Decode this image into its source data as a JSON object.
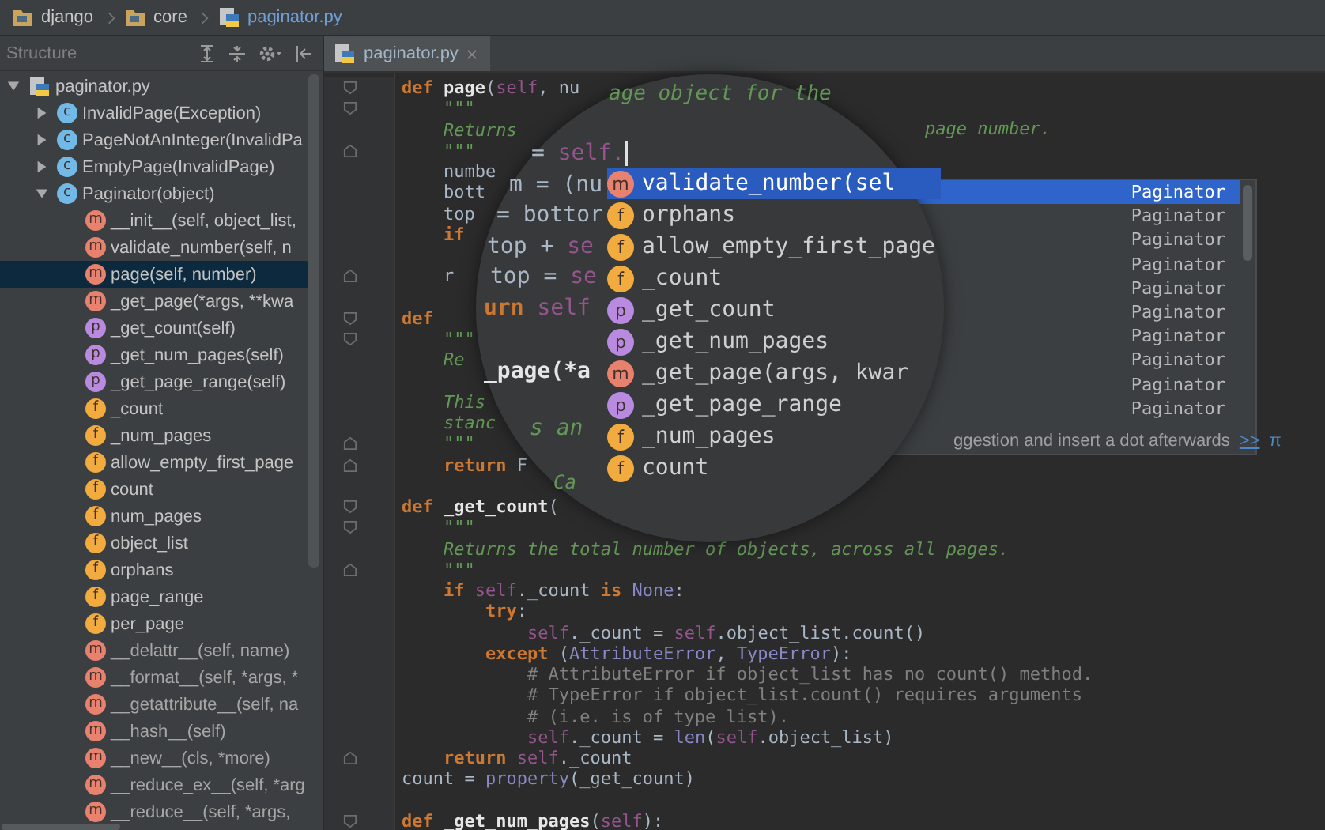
{
  "breadcrumbs": [
    {
      "kind": "folder",
      "label": "django"
    },
    {
      "kind": "folder",
      "label": "core"
    },
    {
      "kind": "file",
      "label": "paginator.py"
    }
  ],
  "structure": {
    "title": "Structure",
    "tree": [
      {
        "kind": "file",
        "label": "paginator.py",
        "expanded": true,
        "selected": false,
        "inherited": false,
        "children": [
          {
            "kind": "class",
            "badge": "c",
            "label": "InvalidPage(Exception)",
            "expanded": false,
            "selected": false,
            "inherited": false
          },
          {
            "kind": "class",
            "badge": "c",
            "label": "PageNotAnInteger(InvalidPa",
            "expanded": false,
            "selected": false,
            "inherited": false
          },
          {
            "kind": "class",
            "badge": "c",
            "label": "EmptyPage(InvalidPage)",
            "expanded": false,
            "selected": false,
            "inherited": false
          },
          {
            "kind": "class",
            "badge": "c",
            "label": "Paginator(object)",
            "expanded": true,
            "selected": false,
            "inherited": false,
            "children": [
              {
                "kind": "method",
                "badge": "m",
                "label": "__init__(self, object_list,",
                "selected": false,
                "inherited": false
              },
              {
                "kind": "method",
                "badge": "m",
                "label": "validate_number(self, n",
                "selected": false,
                "inherited": false
              },
              {
                "kind": "method",
                "badge": "m",
                "label": "page(self, number)",
                "selected": true,
                "inherited": false
              },
              {
                "kind": "method",
                "badge": "m",
                "label": "_get_page(*args, **kwa",
                "selected": false,
                "inherited": false
              },
              {
                "kind": "property",
                "badge": "p",
                "label": "_get_count(self)",
                "selected": false,
                "inherited": false
              },
              {
                "kind": "property",
                "badge": "p",
                "label": "_get_num_pages(self)",
                "selected": false,
                "inherited": false
              },
              {
                "kind": "property",
                "badge": "p",
                "label": "_get_page_range(self)",
                "selected": false,
                "inherited": false
              },
              {
                "kind": "field",
                "badge": "f",
                "label": "_count",
                "selected": false,
                "inherited": false
              },
              {
                "kind": "field",
                "badge": "f",
                "label": "_num_pages",
                "selected": false,
                "inherited": false
              },
              {
                "kind": "field",
                "badge": "f",
                "label": "allow_empty_first_page",
                "selected": false,
                "inherited": false
              },
              {
                "kind": "field",
                "badge": "f",
                "label": "count",
                "selected": false,
                "inherited": false
              },
              {
                "kind": "field",
                "badge": "f",
                "label": "num_pages",
                "selected": false,
                "inherited": false
              },
              {
                "kind": "field",
                "badge": "f",
                "label": "object_list",
                "selected": false,
                "inherited": false
              },
              {
                "kind": "field",
                "badge": "f",
                "label": "orphans",
                "selected": false,
                "inherited": false
              },
              {
                "kind": "field",
                "badge": "f",
                "label": "page_range",
                "selected": false,
                "inherited": false
              },
              {
                "kind": "field",
                "badge": "f",
                "label": "per_page",
                "selected": false,
                "inherited": false
              },
              {
                "kind": "method",
                "badge": "m",
                "label": "__delattr__(self, name)",
                "selected": false,
                "inherited": true
              },
              {
                "kind": "method",
                "badge": "m",
                "label": "__format__(self, *args, *",
                "selected": false,
                "inherited": true
              },
              {
                "kind": "method",
                "badge": "m",
                "label": "__getattribute__(self, na",
                "selected": false,
                "inherited": true
              },
              {
                "kind": "method",
                "badge": "m",
                "label": "__hash__(self)",
                "selected": false,
                "inherited": true
              },
              {
                "kind": "method",
                "badge": "m",
                "label": "__new__(cls, *more)",
                "selected": false,
                "inherited": true
              },
              {
                "kind": "method",
                "badge": "m",
                "label": "__reduce_ex__(self, *arg",
                "selected": false,
                "inherited": true
              },
              {
                "kind": "method",
                "badge": "m",
                "label": "__reduce__(self, *args,",
                "selected": false,
                "inherited": true
              }
            ]
          }
        ]
      }
    ]
  },
  "editor": {
    "tabs": [
      {
        "label": "paginator.py",
        "selected": true
      }
    ],
    "lines": [
      {
        "fold_start": true,
        "fold_end": false,
        "tokens": [
          {
            "kind": "kw",
            "text": "def "
          },
          {
            "kind": "name",
            "text": "page"
          },
          {
            "kind": "plain",
            "text": "("
          },
          {
            "kind": "self",
            "text": "self"
          },
          {
            "kind": "plain",
            "text": ", nu"
          }
        ]
      },
      {
        "fold_start": true,
        "fold_end": false,
        "tokens": [
          {
            "kind": "doc",
            "text": "    \"\"\""
          }
        ]
      },
      {
        "fold_start": false,
        "fold_end": false,
        "tokens": [
          {
            "kind": "doc",
            "text": "    Returns"
          }
        ]
      },
      {
        "fold_start": false,
        "fold_end": true,
        "tokens": [
          {
            "kind": "doc",
            "text": "    \"\"\""
          }
        ]
      },
      {
        "fold_start": false,
        "fold_end": false,
        "tokens": [
          {
            "kind": "plain",
            "text": "    numbe"
          }
        ]
      },
      {
        "fold_start": false,
        "fold_end": false,
        "tokens": [
          {
            "kind": "plain",
            "text": "    bott"
          }
        ]
      },
      {
        "fold_start": false,
        "fold_end": false,
        "tokens": [
          {
            "kind": "plain",
            "text": "    top"
          }
        ]
      },
      {
        "fold_start": false,
        "fold_end": false,
        "tokens": [
          {
            "kind": "kw",
            "text": "    if"
          }
        ]
      },
      {
        "fold_start": false,
        "fold_end": false
      },
      {
        "fold_start": false,
        "fold_end": true,
        "tokens": [
          {
            "kind": "plain",
            "text": "    r"
          }
        ]
      },
      {
        "fold_start": false,
        "fold_end": false
      },
      {
        "fold_start": true,
        "fold_end": false,
        "tokens": [
          {
            "kind": "kw",
            "text": "def"
          }
        ]
      },
      {
        "fold_start": true,
        "fold_end": false,
        "tokens": [
          {
            "kind": "doc",
            "text": "    \"\"\""
          }
        ]
      },
      {
        "fold_start": false,
        "fold_end": false,
        "tokens": [
          {
            "kind": "doc",
            "text": "    Re"
          }
        ]
      },
      {
        "fold_start": false,
        "fold_end": false
      },
      {
        "fold_start": false,
        "fold_end": false,
        "tokens": [
          {
            "kind": "doc",
            "text": "    This"
          }
        ]
      },
      {
        "fold_start": false,
        "fold_end": false,
        "tokens": [
          {
            "kind": "doc",
            "text": "    stanc"
          }
        ]
      },
      {
        "fold_start": false,
        "fold_end": true,
        "tokens": [
          {
            "kind": "doc",
            "text": "    \"\"\""
          }
        ]
      },
      {
        "fold_start": false,
        "fold_end": true,
        "tokens": [
          {
            "kind": "kw",
            "text": "    return"
          },
          {
            "kind": "plain",
            "text": " F"
          }
        ]
      },
      {
        "fold_start": false,
        "fold_end": false
      },
      {
        "fold_start": true,
        "fold_end": false,
        "tokens": [
          {
            "kind": "kw",
            "text": "def "
          },
          {
            "kind": "name",
            "text": "_get_count"
          },
          {
            "kind": "plain",
            "text": "("
          }
        ]
      },
      {
        "fold_start": true,
        "fold_end": false,
        "tokens": [
          {
            "kind": "doc",
            "text": "    \"\"\""
          }
        ]
      },
      {
        "fold_start": false,
        "fold_end": false,
        "tokens": [
          {
            "kind": "doc",
            "text": "    Returns the total number of objects, across all pages."
          }
        ]
      },
      {
        "fold_start": false,
        "fold_end": true,
        "tokens": [
          {
            "kind": "doc",
            "text": "    \"\"\""
          }
        ]
      },
      {
        "fold_start": false,
        "fold_end": false,
        "tokens": [
          {
            "kind": "kw",
            "text": "    if "
          },
          {
            "kind": "self",
            "text": "self"
          },
          {
            "kind": "plain",
            "text": "._count "
          },
          {
            "kind": "kw",
            "text": "is "
          },
          {
            "kind": "builtin",
            "text": "None"
          },
          {
            "kind": "plain",
            "text": ":"
          }
        ]
      },
      {
        "fold_start": false,
        "fold_end": false,
        "tokens": [
          {
            "kind": "kw",
            "text": "        try"
          },
          {
            "kind": "plain",
            "text": ":"
          }
        ]
      },
      {
        "fold_start": false,
        "fold_end": false,
        "tokens": [
          {
            "kind": "self",
            "text": "            self"
          },
          {
            "kind": "plain",
            "text": "._count = "
          },
          {
            "kind": "self",
            "text": "self"
          },
          {
            "kind": "plain",
            "text": ".object_list.count()"
          }
        ]
      },
      {
        "fold_start": false,
        "fold_end": false,
        "tokens": [
          {
            "kind": "kw",
            "text": "        except "
          },
          {
            "kind": "plain",
            "text": "("
          },
          {
            "kind": "builtin",
            "text": "AttributeError"
          },
          {
            "kind": "plain",
            "text": ", "
          },
          {
            "kind": "builtin",
            "text": "TypeError"
          },
          {
            "kind": "plain",
            "text": "):"
          }
        ]
      },
      {
        "fold_start": false,
        "fold_end": false,
        "tokens": [
          {
            "kind": "cmt",
            "text": "            # AttributeError if object_list has no count() method."
          }
        ]
      },
      {
        "fold_start": false,
        "fold_end": false,
        "tokens": [
          {
            "kind": "cmt",
            "text": "            # TypeError if object_list.count() requires arguments"
          }
        ]
      },
      {
        "fold_start": false,
        "fold_end": false,
        "tokens": [
          {
            "kind": "cmt",
            "text": "            # (i.e. is of type list)."
          }
        ]
      },
      {
        "fold_start": false,
        "fold_end": false,
        "tokens": [
          {
            "kind": "self",
            "text": "            self"
          },
          {
            "kind": "plain",
            "text": "._count = "
          },
          {
            "kind": "builtin",
            "text": "len"
          },
          {
            "kind": "plain",
            "text": "("
          },
          {
            "kind": "self",
            "text": "self"
          },
          {
            "kind": "plain",
            "text": ".object_list)"
          }
        ]
      },
      {
        "fold_start": false,
        "fold_end": true,
        "tokens": [
          {
            "kind": "kw",
            "text": "    return "
          },
          {
            "kind": "self",
            "text": "self"
          },
          {
            "kind": "plain",
            "text": "._count"
          }
        ]
      },
      {
        "fold_start": false,
        "fold_end": false,
        "tokens": [
          {
            "kind": "plain",
            "text": "count = "
          },
          {
            "kind": "builtin",
            "text": "property"
          },
          {
            "kind": "plain",
            "text": "(_get_count)"
          }
        ]
      },
      {
        "fold_start": false,
        "fold_end": false
      },
      {
        "fold_start": true,
        "fold_end": false,
        "tokens": [
          {
            "kind": "kw",
            "text": "def "
          },
          {
            "kind": "name",
            "text": "_get_num_pages"
          },
          {
            "kind": "plain",
            "text": "("
          },
          {
            "kind": "self",
            "text": "self"
          },
          {
            "kind": "plain",
            "text": "):"
          }
        ]
      }
    ],
    "docstring_tail": "page number.",
    "magnifier": {
      "fragments": [
        {
          "tokens": [
            {
              "kind": "doc",
              "text": "age object for the"
            }
          ]
        },
        {
          "tokens": [
            {
              "kind": "plain",
              "text": "= "
            },
            {
              "kind": "self",
              "text": "self."
            }
          ]
        },
        {
          "tokens": [
            {
              "kind": "plain",
              "text": "m = (nu"
            }
          ]
        },
        {
          "tokens": [
            {
              "kind": "plain",
              "text": "= bottor"
            }
          ]
        },
        {
          "tokens": [
            {
              "kind": "plain",
              "text": "top + "
            },
            {
              "kind": "self",
              "text": "se"
            }
          ]
        },
        {
          "tokens": [
            {
              "kind": "plain",
              "text": "top = "
            },
            {
              "kind": "self",
              "text": "se"
            }
          ]
        },
        {
          "tokens": [
            {
              "kind": "kw",
              "text": "urn "
            },
            {
              "kind": "self",
              "text": "self"
            }
          ]
        },
        {
          "tokens": [
            {
              "kind": "name",
              "text": "_page(*a"
            }
          ]
        },
        {
          "tokens": [
            {
              "kind": "doc",
              "text": "s an"
            }
          ]
        },
        {
          "tokens": [
            {
              "kind": "doc",
              "text": "Ca"
            }
          ]
        }
      ]
    },
    "completion": {
      "items": [
        {
          "kind": "method",
          "badge": "m",
          "name": "validate_number(sel",
          "type": "Paginator",
          "selected": true
        },
        {
          "kind": "field",
          "badge": "f",
          "name": "orphans",
          "type": "Paginator",
          "selected": false
        },
        {
          "kind": "field",
          "badge": "f",
          "name": "allow_empty_first_page",
          "type": "Paginator",
          "selected": false
        },
        {
          "kind": "field",
          "badge": "f",
          "name": "_count",
          "type": "Paginator",
          "selected": false
        },
        {
          "kind": "property",
          "badge": "p",
          "name": "_get_count",
          "type": "Paginator",
          "selected": false
        },
        {
          "kind": "property",
          "badge": "p",
          "name": "_get_num_pages",
          "type": "Paginator",
          "selected": false
        },
        {
          "kind": "method",
          "badge": "m",
          "name": "_get_page(args, kwar",
          "type": "Paginator",
          "selected": false
        },
        {
          "kind": "property",
          "badge": "p",
          "name": "_get_page_range",
          "type": "Paginator",
          "selected": false
        },
        {
          "kind": "field",
          "badge": "f",
          "name": "_num_pages",
          "type": "Paginator",
          "selected": false
        },
        {
          "kind": "field",
          "badge": "f",
          "name": "count",
          "type": "Paginator",
          "selected": false
        }
      ],
      "hint": "ggestion and insert a dot afterwards",
      "link": ">>",
      "pi": "π"
    }
  }
}
